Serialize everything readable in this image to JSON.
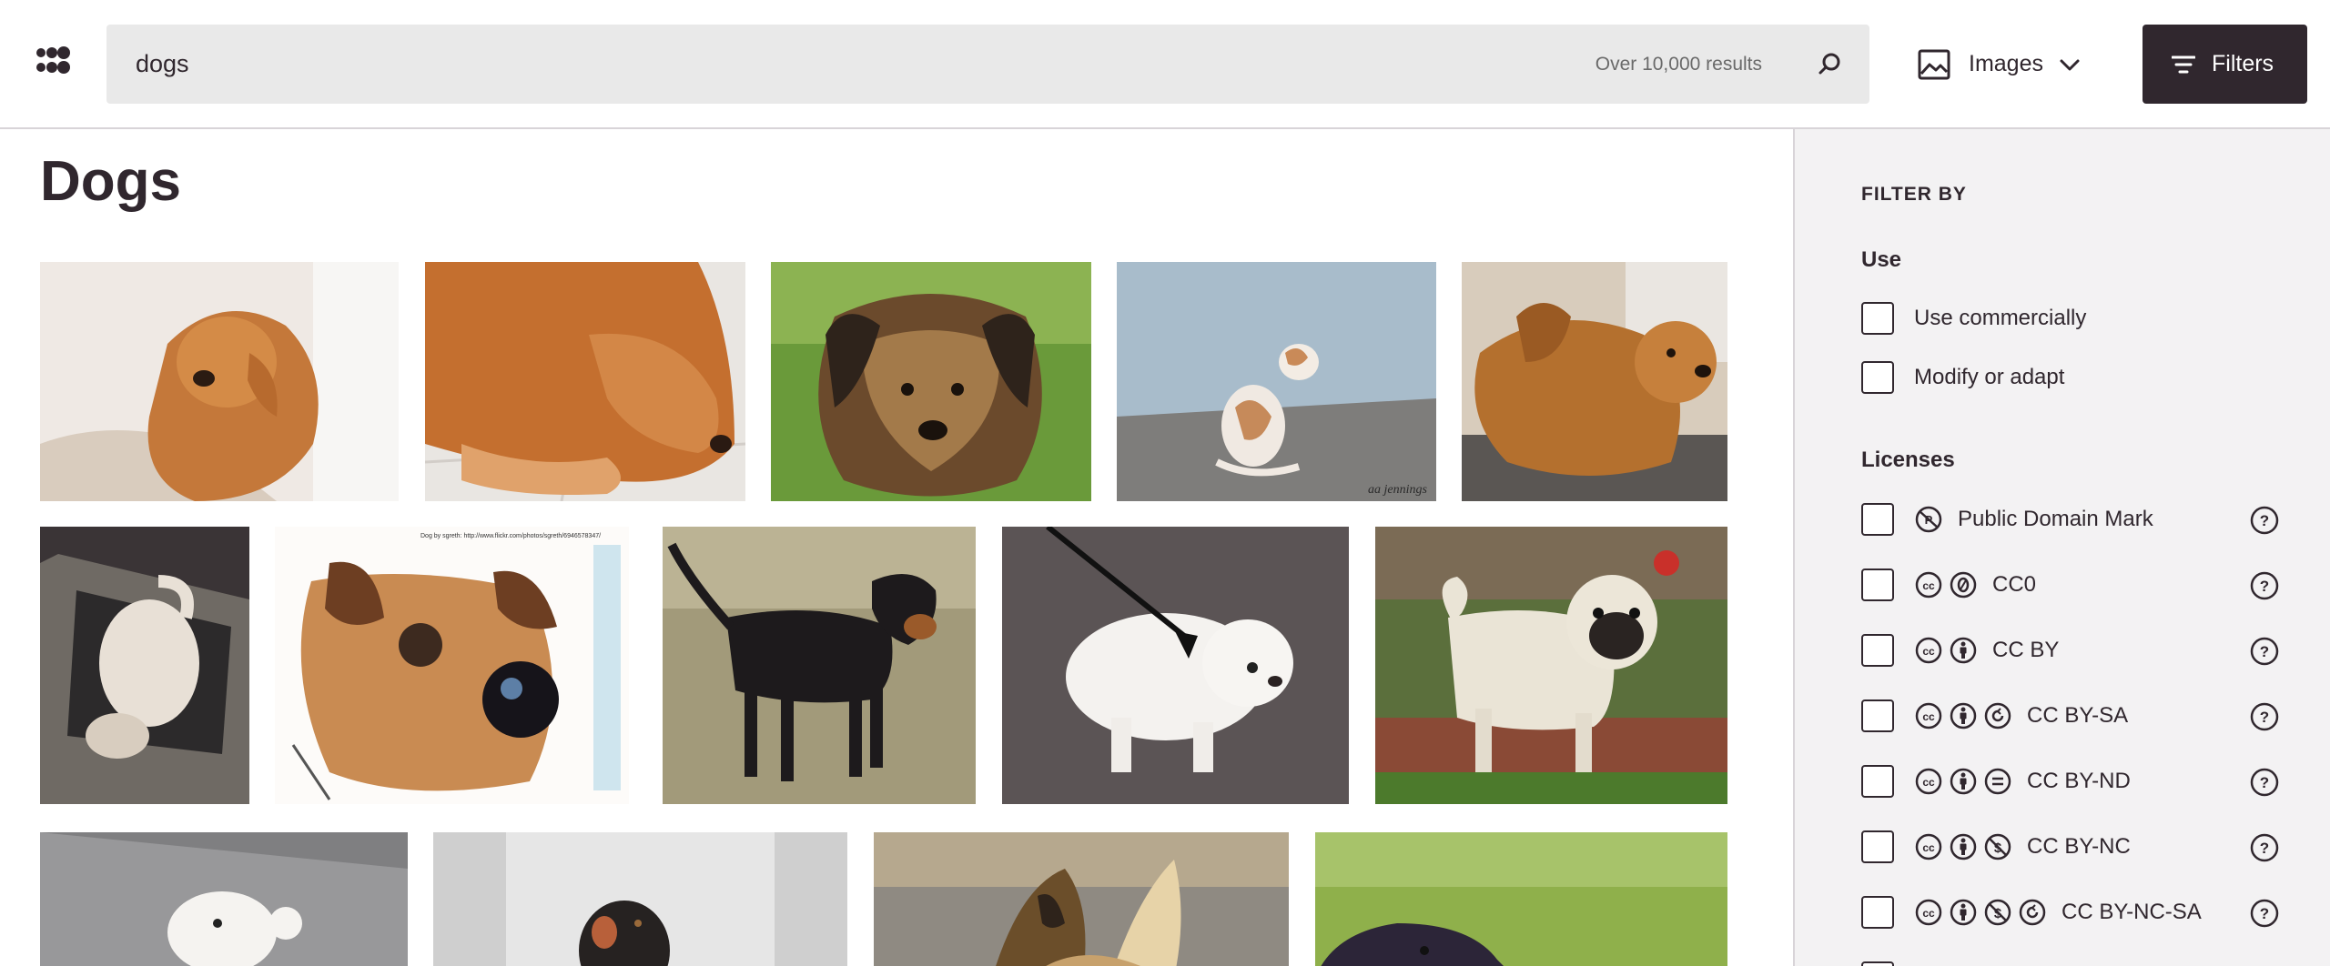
{
  "header": {
    "search_value": "dogs",
    "result_count": "Over 10,000 results",
    "content_type_label": "Images",
    "filters_label": "Filters"
  },
  "main": {
    "page_title": "Dogs",
    "images": [
      {
        "name": "golden-retriever-sitting"
      },
      {
        "name": "golden-retriever-lying"
      },
      {
        "name": "terrier-in-grass"
      },
      {
        "name": "dog-by-wall"
      },
      {
        "name": "golden-dogs-cuddling"
      },
      {
        "name": "white-dog-on-mat"
      },
      {
        "name": "dog-fisheye-portrait"
      },
      {
        "name": "black-tan-dog-in-field"
      },
      {
        "name": "white-fluffy-dog-leash"
      },
      {
        "name": "pug-on-grass"
      },
      {
        "name": "white-dog-on-pavement"
      },
      {
        "name": "black-dog-running"
      },
      {
        "name": "dog-closeup-ears"
      },
      {
        "name": "dark-dog-on-lawn"
      }
    ],
    "photo_captions": {
      "credit_1": "Dog by sgreth: http://www.flickr.com/photos/sgreth/6946578347/",
      "watermark_1": "aa jennings"
    }
  },
  "sidebar": {
    "heading": "FILTER BY",
    "use_title": "Use",
    "use_options": [
      "Use commercially",
      "Modify or adapt"
    ],
    "licenses_title": "Licenses",
    "licenses": [
      {
        "label": "Public Domain Mark",
        "icons": [
          "pdm-icon"
        ]
      },
      {
        "label": "CC0",
        "icons": [
          "cc-icon",
          "zero-icon"
        ]
      },
      {
        "label": "CC BY",
        "icons": [
          "cc-icon",
          "by-icon"
        ]
      },
      {
        "label": "CC BY-SA",
        "icons": [
          "cc-icon",
          "by-icon",
          "sa-icon"
        ]
      },
      {
        "label": "CC BY-ND",
        "icons": [
          "cc-icon",
          "by-icon",
          "nd-icon"
        ]
      },
      {
        "label": "CC BY-NC",
        "icons": [
          "cc-icon",
          "by-icon",
          "nc-icon"
        ]
      },
      {
        "label": "CC BY-NC-SA",
        "icons": [
          "cc-icon",
          "by-icon",
          "nc-icon",
          "sa-icon"
        ]
      }
    ]
  }
}
